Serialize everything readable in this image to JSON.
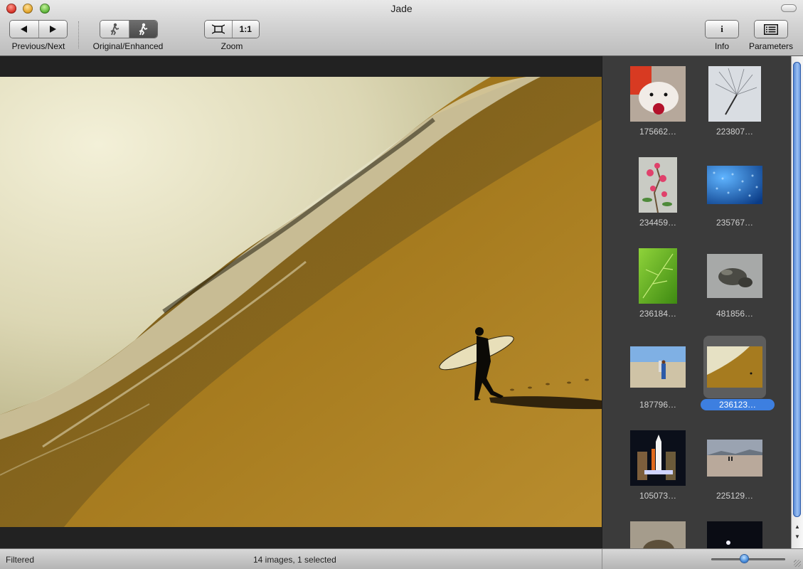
{
  "window": {
    "title": "Jade"
  },
  "toolbar": {
    "nav_label": "Previous/Next",
    "mode_label": "Original/Enhanced",
    "zoom_label": "Zoom",
    "zoom_one_to_one": "1:1",
    "info_button": "i",
    "info_label": "Info",
    "parameters_label": "Parameters"
  },
  "icons": {
    "previous": "triangle-left-icon",
    "next": "triangle-right-icon",
    "original": "figure-original-icon",
    "enhanced": "figure-enhanced-icon",
    "zoom_fit": "fit-frame-icon",
    "parameters": "list-panel-icon"
  },
  "thumbnails": [
    {
      "label": "175662…",
      "kind": "hamster",
      "selected": false
    },
    {
      "label": "223807…",
      "kind": "dandelion",
      "selected": false
    },
    {
      "label": "234459…",
      "kind": "flowers",
      "selected": false
    },
    {
      "label": "235767…",
      "kind": "droplets",
      "selected": false
    },
    {
      "label": "236184…",
      "kind": "leaf",
      "selected": false
    },
    {
      "label": "481856…",
      "kind": "turtles",
      "selected": false
    },
    {
      "label": "187796…",
      "kind": "beach-walk",
      "selected": false
    },
    {
      "label": "236123…",
      "kind": "surfer",
      "selected": true
    },
    {
      "label": "105073…",
      "kind": "shuttle",
      "selected": false
    },
    {
      "label": "225129…",
      "kind": "shore",
      "selected": false
    },
    {
      "label": "",
      "kind": "animal",
      "selected": false
    },
    {
      "label": "",
      "kind": "night",
      "selected": false
    }
  ],
  "status": {
    "left": "Filtered",
    "center": "14 images, 1 selected",
    "thumbnail_size": 0.45
  },
  "colors": {
    "selection": "#3d7fe0",
    "sidebar_bg": "#3b3b3b"
  }
}
